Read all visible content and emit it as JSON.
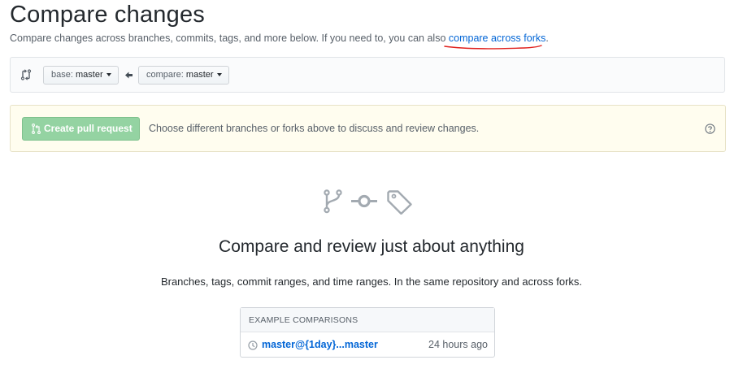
{
  "header": {
    "title": "Compare changes",
    "subtitle_prefix": "Compare changes across branches, commits, tags, and more below. If you need to, you can also ",
    "subtitle_link": "compare across forks",
    "subtitle_suffix": "."
  },
  "range": {
    "base_label": "base:",
    "base_value": "master",
    "compare_label": "compare:",
    "compare_value": "master"
  },
  "notice": {
    "create_pr_label": "Create pull request",
    "message": "Choose different branches or forks above to discuss and review changes."
  },
  "blankslate": {
    "title": "Compare and review just about anything",
    "description": "Branches, tags, commit ranges, and time ranges. In the same repository and across forks."
  },
  "examples": {
    "header": "EXAMPLE COMPARISONS",
    "items": [
      {
        "label": "master@{1day}...master",
        "time": "24 hours ago"
      }
    ]
  },
  "colors": {
    "link": "#0366d6",
    "annotation_underline": "#e0201c",
    "create_pr_disabled": "#94d3a2",
    "notice_bg": "#fffdef"
  },
  "icons": {
    "range_bar": "git-compare-icon",
    "arrow": "arrow-left-icon",
    "create_pr": "git-pull-request-icon",
    "help": "question-icon",
    "hero": [
      "git-branch-icon",
      "git-commit-icon",
      "tag-icon"
    ],
    "example": "clock-icon"
  }
}
